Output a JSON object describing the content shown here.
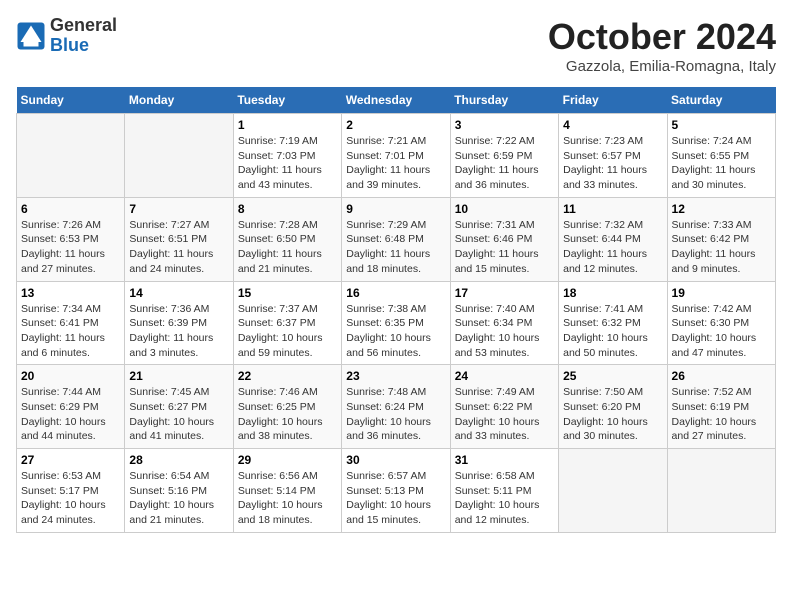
{
  "header": {
    "logo": {
      "general": "General",
      "blue": "Blue"
    },
    "title": "October 2024",
    "location": "Gazzola, Emilia-Romagna, Italy"
  },
  "calendar": {
    "days_of_week": [
      "Sunday",
      "Monday",
      "Tuesday",
      "Wednesday",
      "Thursday",
      "Friday",
      "Saturday"
    ],
    "weeks": [
      [
        {
          "day": "",
          "info": ""
        },
        {
          "day": "",
          "info": ""
        },
        {
          "day": "1",
          "info": "Sunrise: 7:19 AM\nSunset: 7:03 PM\nDaylight: 11 hours and 43 minutes."
        },
        {
          "day": "2",
          "info": "Sunrise: 7:21 AM\nSunset: 7:01 PM\nDaylight: 11 hours and 39 minutes."
        },
        {
          "day": "3",
          "info": "Sunrise: 7:22 AM\nSunset: 6:59 PM\nDaylight: 11 hours and 36 minutes."
        },
        {
          "day": "4",
          "info": "Sunrise: 7:23 AM\nSunset: 6:57 PM\nDaylight: 11 hours and 33 minutes."
        },
        {
          "day": "5",
          "info": "Sunrise: 7:24 AM\nSunset: 6:55 PM\nDaylight: 11 hours and 30 minutes."
        }
      ],
      [
        {
          "day": "6",
          "info": "Sunrise: 7:26 AM\nSunset: 6:53 PM\nDaylight: 11 hours and 27 minutes."
        },
        {
          "day": "7",
          "info": "Sunrise: 7:27 AM\nSunset: 6:51 PM\nDaylight: 11 hours and 24 minutes."
        },
        {
          "day": "8",
          "info": "Sunrise: 7:28 AM\nSunset: 6:50 PM\nDaylight: 11 hours and 21 minutes."
        },
        {
          "day": "9",
          "info": "Sunrise: 7:29 AM\nSunset: 6:48 PM\nDaylight: 11 hours and 18 minutes."
        },
        {
          "day": "10",
          "info": "Sunrise: 7:31 AM\nSunset: 6:46 PM\nDaylight: 11 hours and 15 minutes."
        },
        {
          "day": "11",
          "info": "Sunrise: 7:32 AM\nSunset: 6:44 PM\nDaylight: 11 hours and 12 minutes."
        },
        {
          "day": "12",
          "info": "Sunrise: 7:33 AM\nSunset: 6:42 PM\nDaylight: 11 hours and 9 minutes."
        }
      ],
      [
        {
          "day": "13",
          "info": "Sunrise: 7:34 AM\nSunset: 6:41 PM\nDaylight: 11 hours and 6 minutes."
        },
        {
          "day": "14",
          "info": "Sunrise: 7:36 AM\nSunset: 6:39 PM\nDaylight: 11 hours and 3 minutes."
        },
        {
          "day": "15",
          "info": "Sunrise: 7:37 AM\nSunset: 6:37 PM\nDaylight: 10 hours and 59 minutes."
        },
        {
          "day": "16",
          "info": "Sunrise: 7:38 AM\nSunset: 6:35 PM\nDaylight: 10 hours and 56 minutes."
        },
        {
          "day": "17",
          "info": "Sunrise: 7:40 AM\nSunset: 6:34 PM\nDaylight: 10 hours and 53 minutes."
        },
        {
          "day": "18",
          "info": "Sunrise: 7:41 AM\nSunset: 6:32 PM\nDaylight: 10 hours and 50 minutes."
        },
        {
          "day": "19",
          "info": "Sunrise: 7:42 AM\nSunset: 6:30 PM\nDaylight: 10 hours and 47 minutes."
        }
      ],
      [
        {
          "day": "20",
          "info": "Sunrise: 7:44 AM\nSunset: 6:29 PM\nDaylight: 10 hours and 44 minutes."
        },
        {
          "day": "21",
          "info": "Sunrise: 7:45 AM\nSunset: 6:27 PM\nDaylight: 10 hours and 41 minutes."
        },
        {
          "day": "22",
          "info": "Sunrise: 7:46 AM\nSunset: 6:25 PM\nDaylight: 10 hours and 38 minutes."
        },
        {
          "day": "23",
          "info": "Sunrise: 7:48 AM\nSunset: 6:24 PM\nDaylight: 10 hours and 36 minutes."
        },
        {
          "day": "24",
          "info": "Sunrise: 7:49 AM\nSunset: 6:22 PM\nDaylight: 10 hours and 33 minutes."
        },
        {
          "day": "25",
          "info": "Sunrise: 7:50 AM\nSunset: 6:20 PM\nDaylight: 10 hours and 30 minutes."
        },
        {
          "day": "26",
          "info": "Sunrise: 7:52 AM\nSunset: 6:19 PM\nDaylight: 10 hours and 27 minutes."
        }
      ],
      [
        {
          "day": "27",
          "info": "Sunrise: 6:53 AM\nSunset: 5:17 PM\nDaylight: 10 hours and 24 minutes."
        },
        {
          "day": "28",
          "info": "Sunrise: 6:54 AM\nSunset: 5:16 PM\nDaylight: 10 hours and 21 minutes."
        },
        {
          "day": "29",
          "info": "Sunrise: 6:56 AM\nSunset: 5:14 PM\nDaylight: 10 hours and 18 minutes."
        },
        {
          "day": "30",
          "info": "Sunrise: 6:57 AM\nSunset: 5:13 PM\nDaylight: 10 hours and 15 minutes."
        },
        {
          "day": "31",
          "info": "Sunrise: 6:58 AM\nSunset: 5:11 PM\nDaylight: 10 hours and 12 minutes."
        },
        {
          "day": "",
          "info": ""
        },
        {
          "day": "",
          "info": ""
        }
      ]
    ]
  }
}
